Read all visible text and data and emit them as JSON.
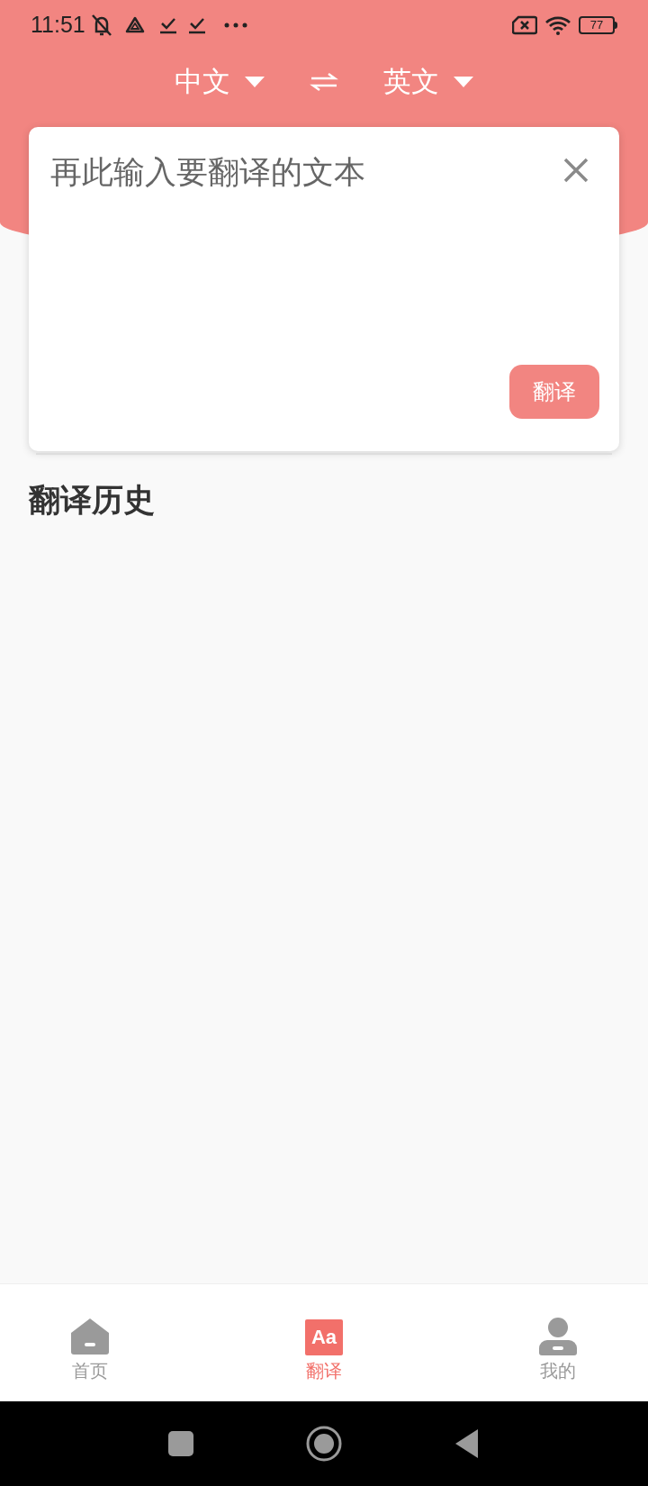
{
  "status_bar": {
    "time": "11:51",
    "battery": "77"
  },
  "language_bar": {
    "source": "中文",
    "target": "英文"
  },
  "input": {
    "placeholder": "再此输入要翻译的文本"
  },
  "translate_button": "翻译",
  "history": {
    "title": "翻译历史"
  },
  "tabs": [
    {
      "label": "首页",
      "kind": "home",
      "selected": false
    },
    {
      "label": "翻译",
      "kind": "translate",
      "icon_text": "Aa",
      "selected": true
    },
    {
      "label": "我的",
      "kind": "profile",
      "selected": false
    }
  ]
}
